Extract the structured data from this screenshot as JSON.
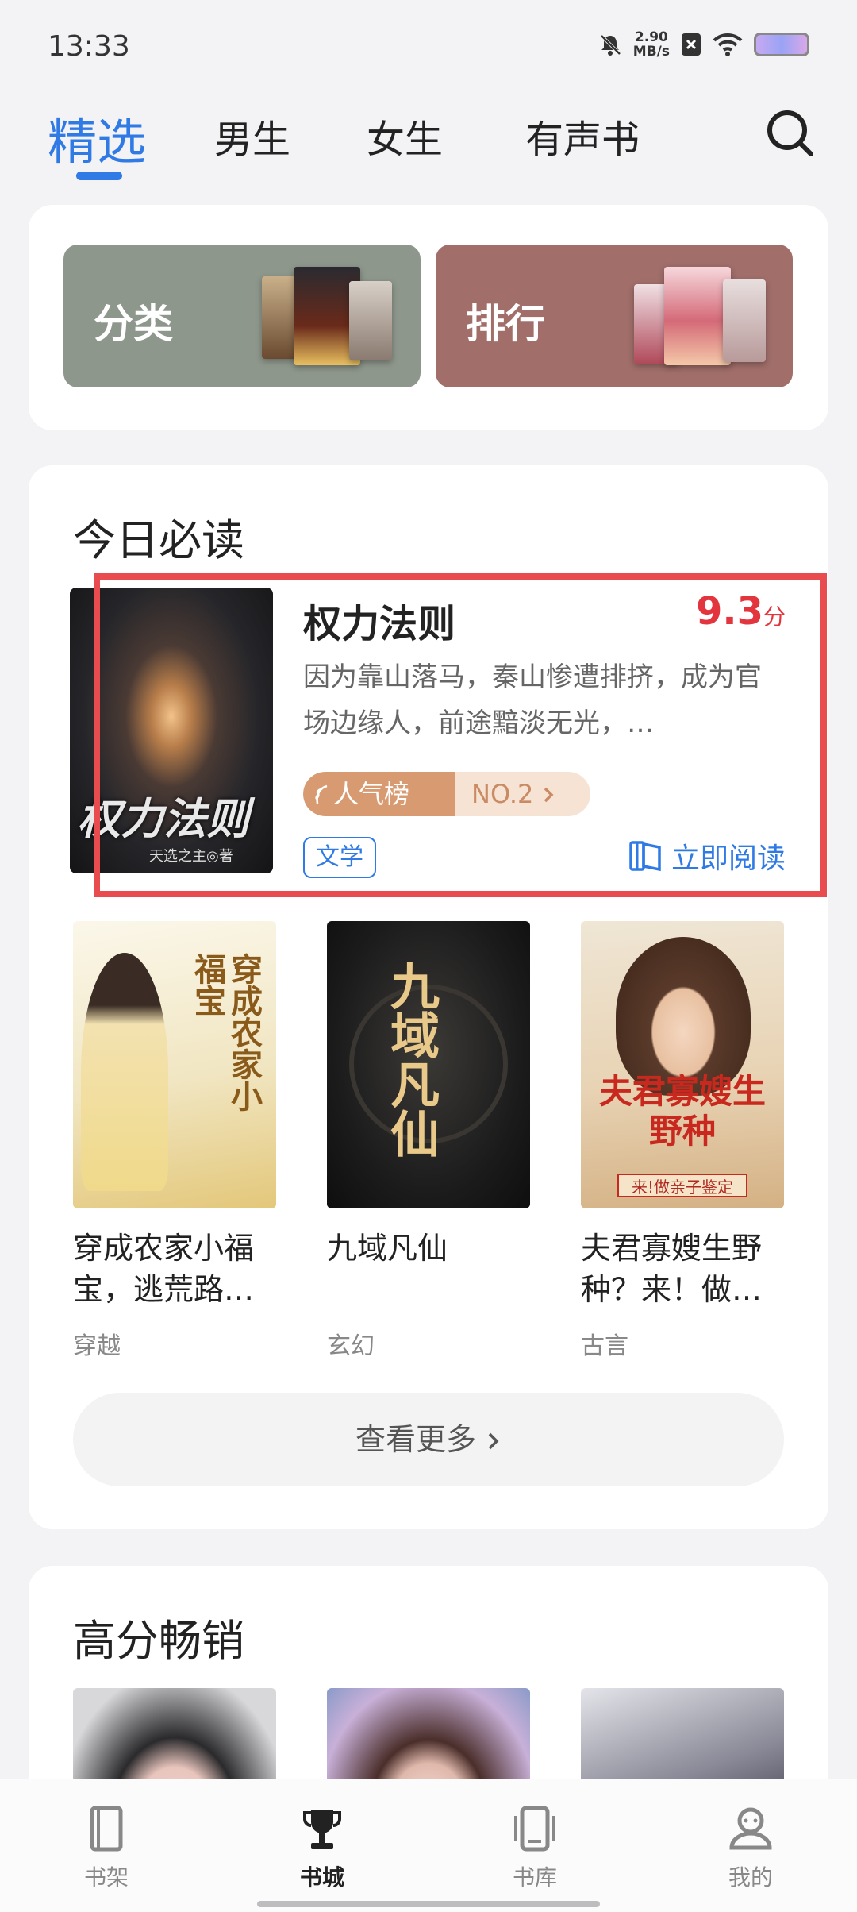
{
  "status": {
    "time": "13:33",
    "net_speed_value": "2.90",
    "net_speed_unit": "MB/s"
  },
  "tabs": [
    {
      "label": "精选",
      "active": true
    },
    {
      "label": "男生",
      "active": false
    },
    {
      "label": "女生",
      "active": false
    },
    {
      "label": "有声书",
      "active": false
    }
  ],
  "shortcuts": {
    "category": "分类",
    "ranking": "排行"
  },
  "today": {
    "title": "今日必读",
    "featured": {
      "title": "权力法则",
      "score": "9.3",
      "score_unit": "分",
      "description": "因为靠山落马，秦山惨遭排挤，成为官场边缘人，前途黯淡无光，…",
      "rank_label": "人气榜",
      "rank_value": "NO.2",
      "genre": "文学",
      "read_label": "立即阅读",
      "cover_title": "权力法则",
      "cover_author": "天选之主◎著"
    },
    "books": [
      {
        "title": "穿成农家小福宝，逃荒路…",
        "genre": "穿越",
        "cover_title": "穿成农家小福宝"
      },
      {
        "title": "九域凡仙",
        "genre": "玄幻",
        "cover_title": "九域凡仙"
      },
      {
        "title": "夫君寡嫂生野种？来！做…",
        "genre": "古言",
        "cover_title": "夫君寡嫂生野种",
        "cover_sub": "来!做亲子鉴定"
      }
    ],
    "see_more": "查看更多"
  },
  "hot": {
    "title": "高分畅销"
  },
  "bottom_nav": [
    {
      "label": "书架",
      "icon": "bookshelf-icon"
    },
    {
      "label": "书城",
      "icon": "trophy-icon",
      "active": true
    },
    {
      "label": "书库",
      "icon": "library-icon"
    },
    {
      "label": "我的",
      "icon": "profile-icon"
    }
  ],
  "colors": {
    "accent": "#2f7ae5",
    "score": "#e2353e",
    "highlight": "#e84c4f"
  }
}
